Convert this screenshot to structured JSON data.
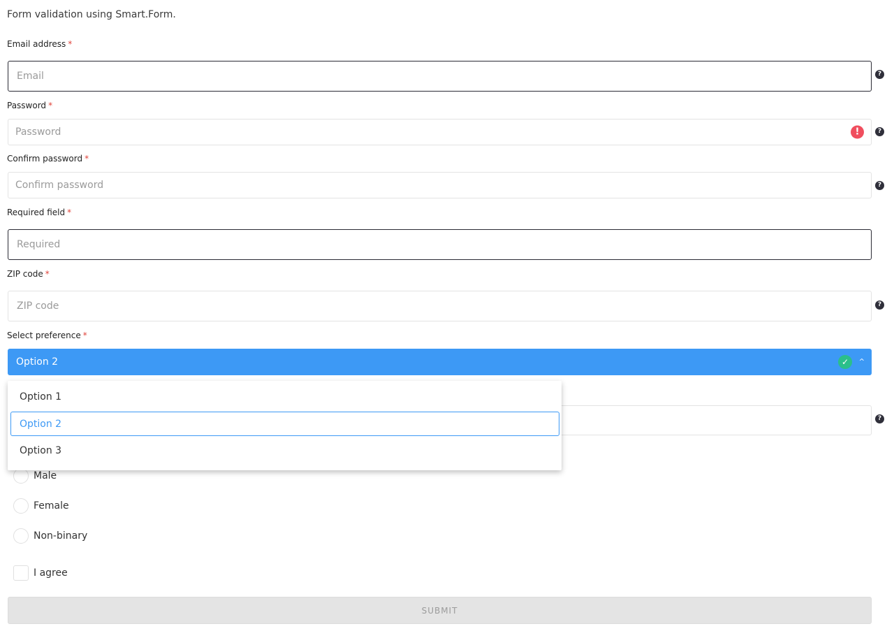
{
  "intro": "Form validation using Smart.Form.",
  "required_marker": "*",
  "help_glyph": "?",
  "fields": {
    "email": {
      "label": "Email address",
      "placeholder": "Email"
    },
    "password": {
      "label": "Password",
      "placeholder": "Password",
      "error_glyph": "!"
    },
    "confirm_password": {
      "label": "Confirm password",
      "placeholder": "Confirm password"
    },
    "required": {
      "label": "Required field",
      "placeholder": "Required"
    },
    "zip": {
      "label": "ZIP code",
      "placeholder": "ZIP code"
    },
    "preference": {
      "label": "Select preference",
      "selected": "Option 2",
      "valid_glyph": "✓",
      "chevron_glyph": "^",
      "options": [
        "Option 1",
        "Option 2",
        "Option 3"
      ]
    }
  },
  "gender_options": [
    "Male",
    "Female",
    "Non-binary"
  ],
  "agree_label": "I agree",
  "submit_label": "SUBMIT",
  "colors": {
    "accent": "#3d99f5",
    "error": "#f04e5e",
    "valid": "#2bbf8a",
    "required": "#e0443b"
  }
}
